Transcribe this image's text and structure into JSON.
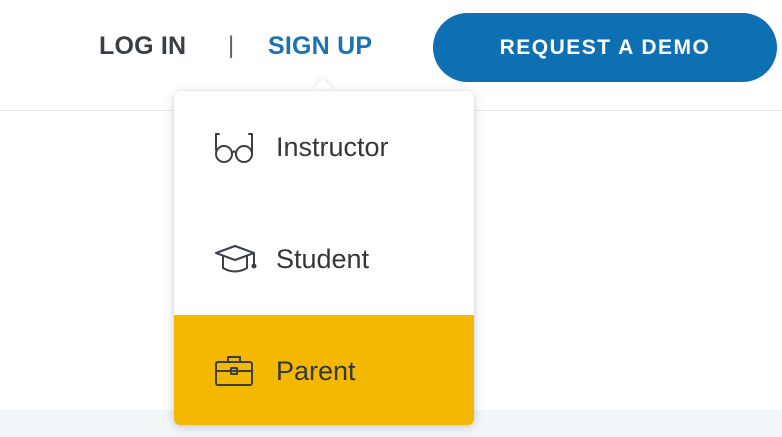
{
  "nav": {
    "login_label": "LOG IN",
    "separator": "|",
    "signup_label": "SIGN UP",
    "demo_label": "REQUEST A DEMO"
  },
  "signup_menu": {
    "items": [
      {
        "label": "Instructor",
        "icon": "glasses-icon"
      },
      {
        "label": "Student",
        "icon": "graduation-cap-icon"
      },
      {
        "label": "Parent",
        "icon": "briefcase-icon",
        "highlighted": true
      }
    ]
  },
  "colors": {
    "brand_blue": "#0f6fb3",
    "signup_blue": "#1c73b3",
    "highlight_yellow": "#f5b800",
    "text_dark": "#33373b"
  }
}
